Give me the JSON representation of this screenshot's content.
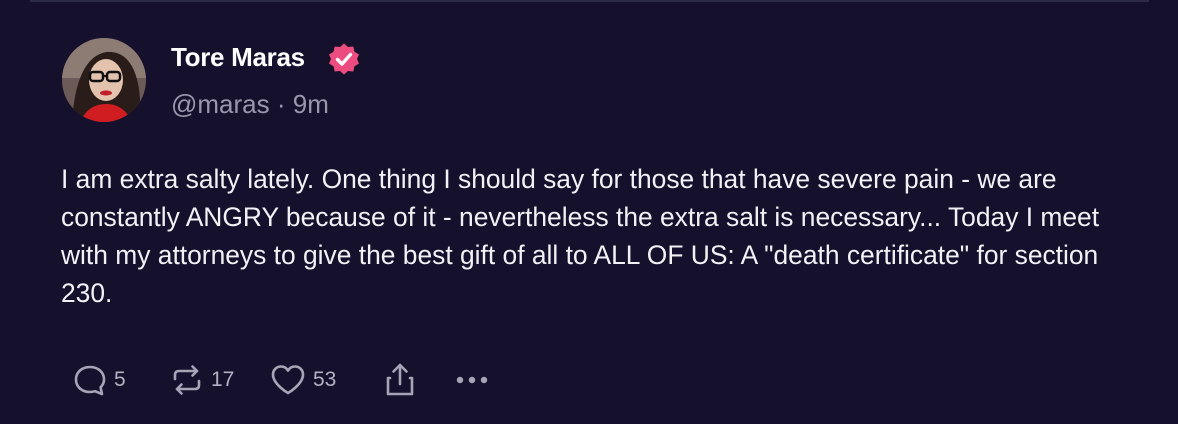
{
  "post": {
    "author_name": "Tore Maras",
    "handle": "@maras",
    "separator": "·",
    "time": "9m",
    "text": "I am extra salty lately. One thing I should say for those that have severe pain - we are constantly ANGRY because of it - nevertheless the extra salt is necessary... Today I meet with my attorneys to give the best gift of all to ALL OF US: A \"death certificate\" for section 230.",
    "verified": true
  },
  "actions": {
    "replies": "5",
    "reposts": "17",
    "likes": "53"
  },
  "icons": {
    "verified": "verified-badge-icon",
    "reply": "reply-bubble-icon",
    "repost": "repost-arrows-icon",
    "like": "heart-icon",
    "share": "share-upload-icon",
    "more": "more-dots-icon"
  },
  "colors": {
    "background": "#15102b",
    "verified_badge": "#ec4c7f",
    "secondary_text": "#9a97ac"
  }
}
